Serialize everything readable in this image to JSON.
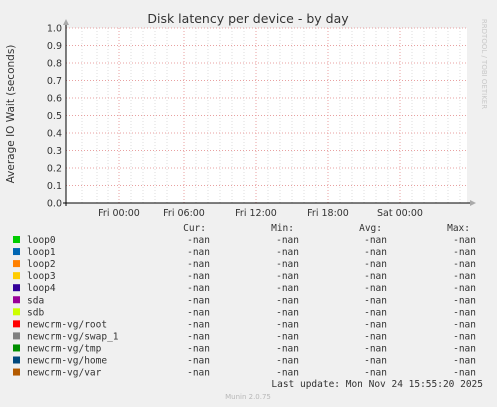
{
  "chart_data": {
    "type": "line",
    "title": "Disk latency per device - by day",
    "ylabel": "Average IO Wait (seconds)",
    "xlabel": "",
    "ylim": [
      0,
      1.0
    ],
    "y_ticks": [
      "0.0",
      "0.1",
      "0.2",
      "0.3",
      "0.4",
      "0.5",
      "0.6",
      "0.7",
      "0.8",
      "0.9",
      "1.0"
    ],
    "x_ticks": [
      "Fri 00:00",
      "Fri 06:00",
      "Fri 12:00",
      "Fri 18:00",
      "Sat 00:00"
    ],
    "grid": true,
    "series": [
      {
        "name": "loop0",
        "color": "#00cc00",
        "cur": "-nan",
        "min": "-nan",
        "avg": "-nan",
        "max": "-nan",
        "values": []
      },
      {
        "name": "loop1",
        "color": "#0066b3",
        "cur": "-nan",
        "min": "-nan",
        "avg": "-nan",
        "max": "-nan",
        "values": []
      },
      {
        "name": "loop2",
        "color": "#ff8000",
        "cur": "-nan",
        "min": "-nan",
        "avg": "-nan",
        "max": "-nan",
        "values": []
      },
      {
        "name": "loop3",
        "color": "#ffcc00",
        "cur": "-nan",
        "min": "-nan",
        "avg": "-nan",
        "max": "-nan",
        "values": []
      },
      {
        "name": "loop4",
        "color": "#330099",
        "cur": "-nan",
        "min": "-nan",
        "avg": "-nan",
        "max": "-nan",
        "values": []
      },
      {
        "name": "sda",
        "color": "#990099",
        "cur": "-nan",
        "min": "-nan",
        "avg": "-nan",
        "max": "-nan",
        "values": []
      },
      {
        "name": "sdb",
        "color": "#ccff00",
        "cur": "-nan",
        "min": "-nan",
        "avg": "-nan",
        "max": "-nan",
        "values": []
      },
      {
        "name": "newcrm-vg/root",
        "color": "#ff0000",
        "cur": "-nan",
        "min": "-nan",
        "avg": "-nan",
        "max": "-nan",
        "values": []
      },
      {
        "name": "newcrm-vg/swap_1",
        "color": "#808080",
        "cur": "-nan",
        "min": "-nan",
        "avg": "-nan",
        "max": "-nan",
        "values": []
      },
      {
        "name": "newcrm-vg/tmp",
        "color": "#008f00",
        "cur": "-nan",
        "min": "-nan",
        "avg": "-nan",
        "max": "-nan",
        "values": []
      },
      {
        "name": "newcrm-vg/home",
        "color": "#00487d",
        "cur": "-nan",
        "min": "-nan",
        "avg": "-nan",
        "max": "-nan",
        "values": []
      },
      {
        "name": "newcrm-vg/var",
        "color": "#b35a00",
        "cur": "-nan",
        "min": "-nan",
        "avg": "-nan",
        "max": "-nan",
        "values": []
      }
    ]
  },
  "legend_headers": {
    "cur": "Cur:",
    "min": "Min:",
    "avg": "Avg:",
    "max": "Max:"
  },
  "last_update": "Last update: Mon Nov 24 15:55:20 2025",
  "watermark": "RRDTOOL / TOBI OETIKER",
  "footer": "Munin 2.0.75",
  "colors": {
    "background": "#f0f0f0",
    "plot": "#ffffff",
    "major_grid": "#e8a0a0",
    "minor_grid": "#dddddd"
  }
}
